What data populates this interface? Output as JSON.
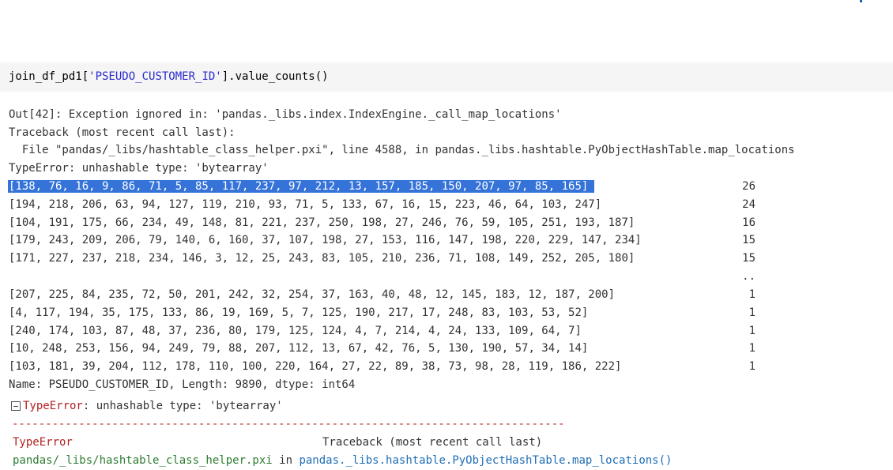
{
  "input_cell": {
    "code_prefix": "join_df_pd1[",
    "code_string": "'PSEUDO_CUSTOMER_ID'",
    "code_suffix": "].value_counts()"
  },
  "output": {
    "line1": "Out[42]: Exception ignored in: 'pandas._libs.index.IndexEngine._call_map_locations'",
    "line2": "Traceback (most recent call last):",
    "line3": "  File \"pandas/_libs/hashtable_class_helper.pxi\", line 4588, in pandas._libs.hashtable.PyObjectHashTable.map_locations",
    "line4": "TypeError: unhashable type: 'bytearray'",
    "rows_top": [
      {
        "key": "[138, 76, 16, 9, 86, 71, 5, 85, 117, 237, 97, 212, 13, 157, 185, 150, 207, 97, 85, 165]",
        "count": "26"
      },
      {
        "key": "[194, 218, 206, 63, 94, 127, 119, 210, 93, 71, 5, 133, 67, 16, 15, 223, 46, 64, 103, 247]",
        "count": "24"
      },
      {
        "key": "[104, 191, 175, 66, 234, 49, 148, 81, 221, 237, 250, 198, 27, 246, 76, 59, 105, 251, 193, 187]",
        "count": "16"
      },
      {
        "key": "[179, 243, 209, 206, 79, 140, 6, 160, 37, 107, 198, 27, 153, 116, 147, 198, 220, 229, 147, 234]",
        "count": "15"
      },
      {
        "key": "[171, 227, 237, 218, 234, 146, 3, 12, 25, 243, 83, 105, 210, 236, 71, 108, 149, 252, 205, 180]",
        "count": "15"
      }
    ],
    "ellipsis": "..",
    "rows_bottom": [
      {
        "key": "[207, 225, 84, 235, 72, 50, 201, 242, 32, 254, 37, 163, 40, 48, 12, 145, 183, 12, 187, 200]",
        "count": "1"
      },
      {
        "key": "[4, 117, 194, 35, 175, 133, 86, 19, 169, 5, 7, 125, 190, 217, 17, 248, 83, 103, 53, 52]",
        "count": "1"
      },
      {
        "key": "[240, 174, 103, 87, 48, 37, 236, 80, 179, 125, 124, 4, 7, 214, 4, 24, 133, 109, 64, 7]",
        "count": "1"
      },
      {
        "key": "[10, 248, 253, 156, 94, 249, 79, 88, 207, 112, 13, 67, 42, 76, 5, 130, 190, 57, 34, 14]",
        "count": "1"
      },
      {
        "key": "[103, 181, 39, 204, 112, 178, 110, 100, 220, 164, 27, 22, 89, 38, 73, 98, 28, 119, 186, 222]",
        "count": "1"
      }
    ],
    "summary": "Name: PSEUDO_CUSTOMER_ID, Length: 9890, dtype: int64"
  },
  "error": {
    "name": "TypeError",
    "message": ": unhashable type: 'bytearray'",
    "dashes": "---------------------------------------------------------------------------------------------",
    "tb_type": "TypeError",
    "tb_header": "Traceback (most recent call last)",
    "tb_file": "pandas/_libs/hashtable_class_helper.pxi",
    "tb_in": " in ",
    "tb_func": "pandas._libs.hashtable.PyObjectHashTable.map_locations()"
  },
  "colors": {
    "highlight": "#3573d8",
    "error_red": "#b22222",
    "string_blue": "#2b2bcc",
    "file_green": "#2e7d32",
    "func_blue": "#1f6fb5",
    "input_bg": "#f5f5f5"
  },
  "icons": {
    "error_toggle": "collapse-minus-icon"
  }
}
